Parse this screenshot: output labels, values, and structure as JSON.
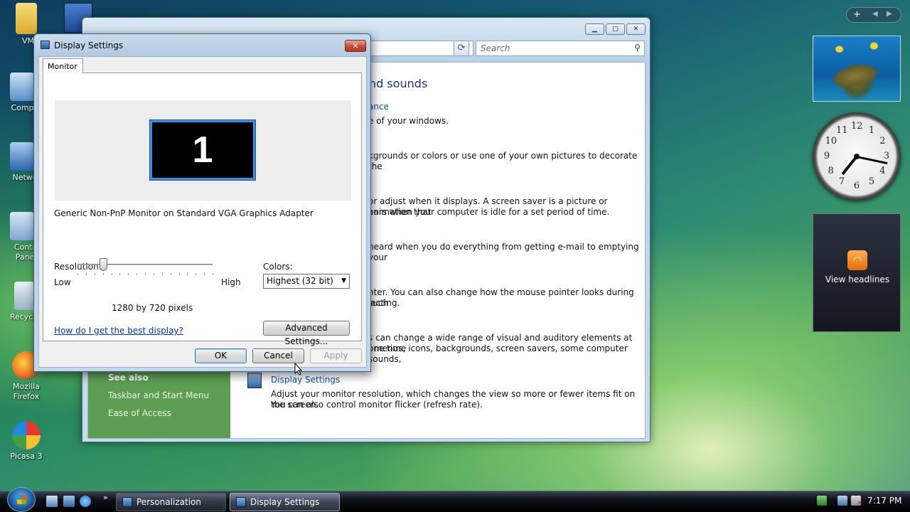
{
  "desktop": {
    "icons": [
      {
        "label": "VM2"
      },
      {
        "label": "Compu"
      },
      {
        "label": "Netwo"
      },
      {
        "label": "Contr\nPane"
      },
      {
        "label": "Recycle"
      },
      {
        "label": "Mozilla Firefox"
      },
      {
        "label": "Picasa 3"
      }
    ]
  },
  "background_window": {
    "search_placeholder": "Search",
    "heading_fragment": "nd sounds",
    "fragments": {
      "appearance_link": "ance",
      "appearance_desc": "e of your windows.",
      "background_desc": "kgrounds or colors or use one of your own pictures to decorate the",
      "screensaver_desc_1": "or adjust when it displays. A screen saver is a picture or animation that",
      "screensaver_desc_2": "ears when your computer is idle for a set period of time.",
      "sounds_desc": "heard when you do everything from getting e-mail to emptying your",
      "pointer_desc_1": "nter. You can also change how the mouse pointer looks during such",
      "pointer_desc_2": "lecting.",
      "theme_desc_1": "s can change a wide range of visual and auditory elements at one time",
      "theme_desc_2": "f menus, icons, backgrounds, screen savers, some computer sounds,"
    },
    "display_settings": {
      "link": "Display Settings",
      "desc_1": "Adjust your monitor resolution, which changes the view so more or fewer items fit on the screen.",
      "desc_2": "You can also control monitor flicker (refresh rate)."
    },
    "see_also": {
      "title": "See also",
      "items": [
        "Taskbar and Start Menu",
        "Ease of Access"
      ]
    }
  },
  "dialog": {
    "title": "Display Settings",
    "close_glyph": "✕",
    "tab": "Monitor",
    "monitor_number": "1",
    "monitor_description": "Generic Non-PnP Monitor on Standard VGA Graphics Adapter",
    "resolution": {
      "label": "Resolution:",
      "low": "Low",
      "high": "High",
      "value_text": "1280 by 720 pixels",
      "level": 0.19
    },
    "colors": {
      "label": "Colors:",
      "selected": "Highest (32 bit)"
    },
    "advanced_button": "Advanced Settings...",
    "help_link": "How do I get the best display?",
    "ok": "OK",
    "cancel": "Cancel",
    "apply": "Apply"
  },
  "gadgets": {
    "feed_label": "View headlines",
    "clock_numbers": [
      "12",
      "1",
      "2",
      "3",
      "4",
      "5",
      "6",
      "7",
      "8",
      "9",
      "10",
      "11"
    ]
  },
  "taskbar": {
    "buttons": [
      {
        "label": "Personalization",
        "active": false
      },
      {
        "label": "Display Settings",
        "active": true
      }
    ],
    "time": "7:17 PM"
  },
  "colors": {
    "accent_blue": "#3f8ee4",
    "link_blue": "#0033cc",
    "close_red": "#c74a34"
  }
}
